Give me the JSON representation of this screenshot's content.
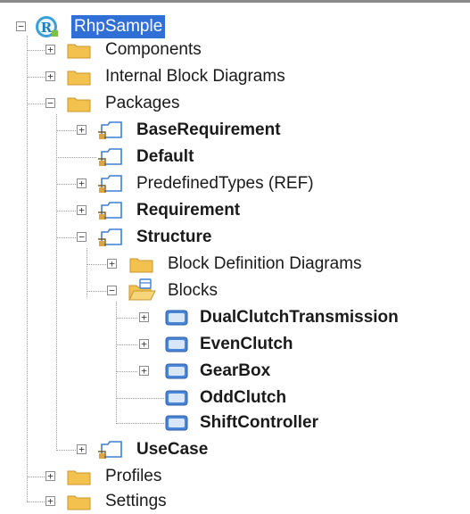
{
  "tree": {
    "root": {
      "label": "RhpSample",
      "expanded": true,
      "selected": true
    },
    "items": [
      {
        "label": "Components",
        "icon": "folder-icon",
        "bold": false,
        "expanded": false
      },
      {
        "label": "Internal Block Diagrams",
        "icon": "folder-icon",
        "bold": false,
        "expanded": false
      },
      {
        "label": "Packages",
        "icon": "folder-icon",
        "bold": false,
        "expanded": true
      },
      {
        "label": "BaseRequirement",
        "icon": "package-icon",
        "bold": true,
        "expanded": false
      },
      {
        "label": "Default",
        "icon": "package-icon",
        "bold": true,
        "expanded": null
      },
      {
        "label": "PredefinedTypes (REF)",
        "icon": "package-icon",
        "bold": false,
        "expanded": false
      },
      {
        "label": "Requirement",
        "icon": "package-icon",
        "bold": true,
        "expanded": false
      },
      {
        "label": "Structure",
        "icon": "package-icon",
        "bold": true,
        "expanded": true
      },
      {
        "label": "Block Definition Diagrams",
        "icon": "folder-icon",
        "bold": false,
        "expanded": false
      },
      {
        "label": "Blocks",
        "icon": "folder-open-icon",
        "bold": false,
        "expanded": true
      },
      {
        "label": "DualClutchTransmission",
        "icon": "block-icon",
        "bold": true,
        "expanded": false
      },
      {
        "label": "EvenClutch",
        "icon": "block-icon",
        "bold": true,
        "expanded": false
      },
      {
        "label": "GearBox",
        "icon": "block-icon",
        "bold": true,
        "expanded": false
      },
      {
        "label": "OddClutch",
        "icon": "block-icon",
        "bold": true,
        "expanded": null
      },
      {
        "label": "ShiftController",
        "icon": "block-icon",
        "bold": true,
        "expanded": null
      },
      {
        "label": "UseCase",
        "icon": "package-icon",
        "bold": true,
        "expanded": false
      },
      {
        "label": "Profiles",
        "icon": "folder-icon",
        "bold": false,
        "expanded": false
      },
      {
        "label": "Settings",
        "icon": "folder-icon",
        "bold": false,
        "expanded": false
      }
    ]
  },
  "colors": {
    "selection": "#2f6fd6",
    "folder": "#f2c14e",
    "block": "#4a86d8",
    "root_icon": "#3aa0d6"
  }
}
